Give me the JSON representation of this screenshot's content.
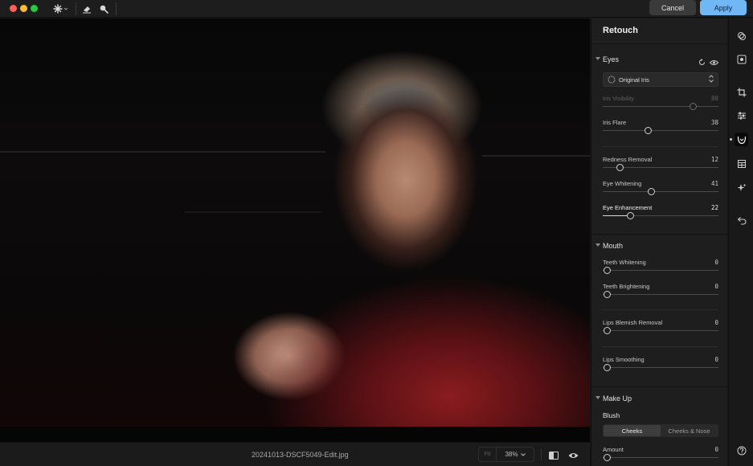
{
  "toolbar": {
    "cancel_label": "Cancel",
    "apply_label": "Apply",
    "tools": [
      "magic-wand-icon",
      "eraser-icon",
      "brush-icon"
    ]
  },
  "status": {
    "filename": "20241013-DSCF5049-Edit.jpg",
    "fit_label": "Fit",
    "zoom_label": "38%"
  },
  "panel": {
    "title": "Retouch",
    "eyes": {
      "label": "Eyes",
      "iris_select": "Original Iris",
      "iris_visibility": {
        "label": "Iris Visibility",
        "value": "80",
        "fraction": 0.8
      },
      "iris_flare": {
        "label": "Iris Flare",
        "value": "38",
        "fraction": 0.38
      },
      "redness_removal": {
        "label": "Redness Removal",
        "value": "12",
        "fraction": 0.12
      },
      "eye_whitening": {
        "label": "Eye Whitening",
        "value": "41",
        "fraction": 0.41
      },
      "eye_enhancement": {
        "label": "Eye Enhancement",
        "value": "22",
        "fraction": 0.22
      }
    },
    "mouth": {
      "label": "Mouth",
      "teeth_whitening": {
        "label": "Teeth Whitening",
        "value": "0",
        "fraction": 0
      },
      "teeth_brightening": {
        "label": "Teeth Brightening",
        "value": "0",
        "fraction": 0
      },
      "lips_blemish_removal": {
        "label": "Lips Blemish Removal",
        "value": "0",
        "fraction": 0
      },
      "lips_smoothing": {
        "label": "Lips Smoothing",
        "value": "0",
        "fraction": 0
      }
    },
    "makeup": {
      "label": "Make Up",
      "blush_label": "Blush",
      "tabs": [
        "Cheeks",
        "Cheeks & Nose"
      ],
      "active_tab": "Cheeks",
      "amount": {
        "label": "Amount",
        "value": "0",
        "fraction": 0
      }
    }
  },
  "sidebar": {
    "icons": [
      "layers-icon",
      "focus-icon",
      "crop-icon",
      "adjust-sliders-icon",
      "retouch-face-icon",
      "grid-icon",
      "sparkle-icon",
      "undo-icon",
      "help-icon"
    ],
    "active": "retouch-face-icon"
  },
  "colors": {
    "apply_button": "#6fb7f5",
    "cancel_button": "#3a3a3a",
    "panel_bg": "#1e1e1e"
  }
}
